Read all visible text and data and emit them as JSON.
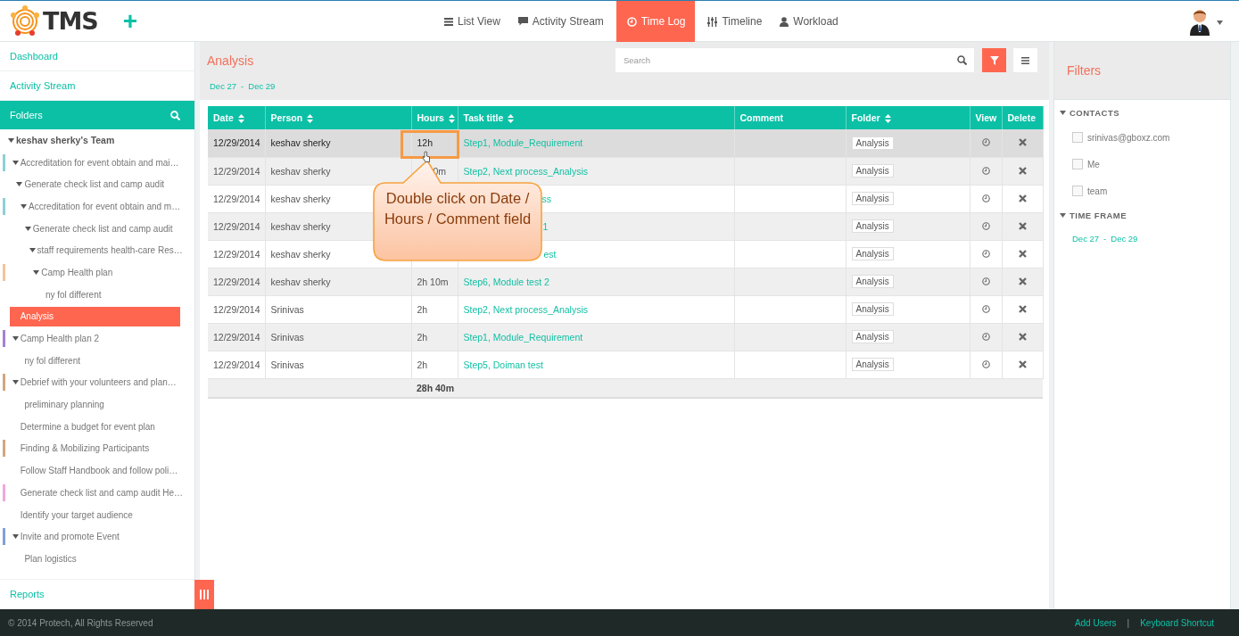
{
  "header": {
    "logo": "TMS",
    "add_label": "+",
    "nav": [
      {
        "label": "List View",
        "selected": false
      },
      {
        "label": "Activity Stream",
        "selected": false
      },
      {
        "label": "Time Log",
        "selected": true
      },
      {
        "label": "Timeline",
        "selected": false
      },
      {
        "label": "Workload",
        "selected": false
      }
    ]
  },
  "sidebar": {
    "links": [
      "Dashboard",
      "Activity Stream"
    ],
    "folders_title": "Folders",
    "tree": [
      {
        "label": "keshav sherky's Team",
        "expanded": true,
        "selected": false,
        "children": [
          {
            "label": "Accreditation for event obtain and mai…",
            "color": "#8ecfd6",
            "expanded": true,
            "selected": false,
            "children": [
              {
                "label": "Generate check list and camp audit",
                "expanded": true,
                "selected": false,
                "children": [
                  {
                    "label": "Accreditation for event obtain and m…",
                    "color": "#8ecfd6",
                    "expanded": true,
                    "selected": false,
                    "children": [
                      {
                        "label": "Generate check list and camp audit",
                        "expanded": true,
                        "selected": false,
                        "children": [
                          {
                            "label": "staff requirements health-care Res…",
                            "expanded": true,
                            "selected": false,
                            "children": [
                              {
                                "label": "Camp Health plan",
                                "color": "#f7c39a",
                                "expanded": true,
                                "selected": false,
                                "children": [
                                  {
                                    "label": "ny fol different",
                                    "selected": false
                                  }
                                ]
                              }
                            ]
                          }
                        ]
                      }
                    ]
                  }
                ]
              }
            ]
          },
          {
            "label": "Analysis",
            "selected": true
          },
          {
            "label": "Camp Health plan 2",
            "color": "#a581d4",
            "expanded": true,
            "selected": false,
            "children": [
              {
                "label": "ny fol different",
                "selected": false
              }
            ]
          },
          {
            "label": "Debrief with your volunteers and plan…",
            "color": "#d3a67e",
            "expanded": true,
            "selected": false,
            "children": [
              {
                "label": "preliminary planning",
                "selected": false
              }
            ]
          },
          {
            "label": "Determine a budget for event plan",
            "selected": false
          },
          {
            "label": "Finding & Mobilizing Participants",
            "color": "#d3a67e",
            "selected": false
          },
          {
            "label": "Follow Staff Handbook and follow poli…",
            "selected": false
          },
          {
            "label": "Generate check list and camp audit He…",
            "color": "#f0a8dc",
            "selected": false
          },
          {
            "label": "Identify your target audience",
            "selected": false
          },
          {
            "label": "Invite and promote Event",
            "color": "#819fd9",
            "expanded": true,
            "selected": false,
            "children": [
              {
                "label": "Plan logistics",
                "selected": false
              }
            ]
          }
        ]
      }
    ],
    "reports": "Reports"
  },
  "main": {
    "title": "Analysis",
    "search": {
      "placeholder": "Search"
    },
    "date_from": "Dec 27",
    "date_sep": "-",
    "date_to": "Dec 29",
    "table": {
      "columns": [
        {
          "label": "Date",
          "sortable": true
        },
        {
          "label": "Person",
          "sortable": true
        },
        {
          "label": "Hours",
          "sortable": true
        },
        {
          "label": "Task title",
          "sortable": true
        },
        {
          "label": "Comment",
          "sortable": false
        },
        {
          "label": "Folder",
          "sortable": true
        },
        {
          "label": "View",
          "sortable": false
        },
        {
          "label": "Delete",
          "sortable": false
        }
      ],
      "rows": [
        {
          "date": "12/29/2014",
          "person": "keshav sherky",
          "hours": "12h",
          "task": "Step1, Module_Requirement",
          "folder": "Analysis",
          "hovered": true
        },
        {
          "date": "12/29/2014",
          "person": "keshav sherky",
          "hours": "0m",
          "task": "Step2, Next process_Analysis",
          "folder": "Analysis",
          "hovered": false
        },
        {
          "date": "12/29/2014",
          "person": "keshav sherky",
          "task": "ss",
          "folder": "Analysis",
          "hovered": false
        },
        {
          "date": "12/29/2014",
          "person": "keshav sherky",
          "task": "1",
          "folder": "Analysis",
          "hovered": false
        },
        {
          "date": "12/29/2014",
          "person": "keshav sherky",
          "task": "est",
          "folder": "Analysis",
          "hovered": false
        },
        {
          "date": "12/29/2014",
          "person": "keshav sherky",
          "hours": "2h 10m",
          "task": "Step6, Module test 2",
          "folder": "Analysis",
          "hovered": false
        },
        {
          "date": "12/29/2014",
          "person": "Srinivas",
          "hours": "2h",
          "task": "Step2, Next process_Analysis",
          "folder": "Analysis",
          "hovered": false
        },
        {
          "date": "12/29/2014",
          "person": "Srinivas",
          "hours": "2h",
          "task": "Step1, Module_Requirement",
          "folder": "Analysis",
          "hovered": false
        },
        {
          "date": "12/29/2014",
          "person": "Srinivas",
          "hours": "2h",
          "task": "Step5, Doiman test",
          "folder": "Analysis",
          "hovered": false
        }
      ],
      "total": "28h 40m"
    },
    "callout": "Double click on Date / Hours / Comment field"
  },
  "filters": {
    "title": "Filters",
    "contacts_title": "CONTACTS",
    "contacts": [
      {
        "label": "srinivas@gboxz.com",
        "checked": false
      },
      {
        "label": "Me",
        "checked": false
      },
      {
        "label": "team",
        "checked": false
      }
    ],
    "time_frame_title": "TIME FRAME",
    "date_from": "Dec 27",
    "date_sep": "-",
    "date_to": "Dec 29"
  },
  "footer": {
    "copyright": "© 2014 Protech, All Rights Reserved",
    "links": [
      "Add Users",
      "Keyboard Shortcut"
    ],
    "separator": "|"
  }
}
